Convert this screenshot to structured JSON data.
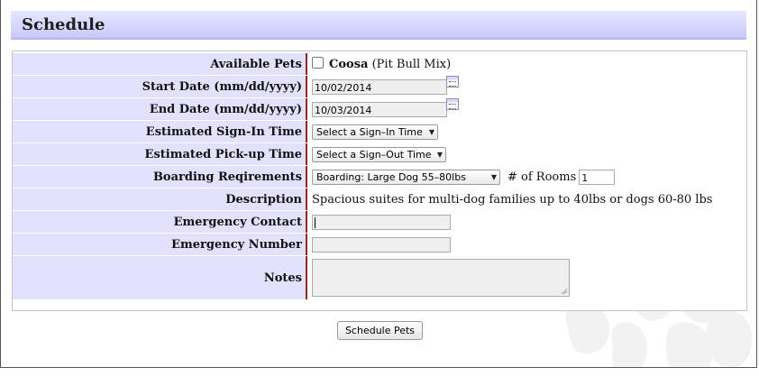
{
  "header": {
    "title": "Schedule"
  },
  "form": {
    "available_pets": {
      "label": "Available Pets",
      "pet_name": "Coosa",
      "pet_breed": "(Pit Bull Mix)",
      "checked": false
    },
    "start_date": {
      "label": "Start Date (mm/dd/yyyy)",
      "value": "10/02/2014"
    },
    "end_date": {
      "label": "End Date (mm/dd/yyyy)",
      "value": "10/03/2014"
    },
    "sign_in": {
      "label": "Estimated Sign-In Time",
      "selected": "Select a Sign–In Time"
    },
    "pick_up": {
      "label": "Estimated Pick-up Time",
      "selected": "Select a Sign–Out Time"
    },
    "boarding": {
      "label": "Boarding Reqirements",
      "selected": "Boarding: Large Dog 55–80lbs",
      "rooms_label": "# of Rooms",
      "rooms_value": "1"
    },
    "description": {
      "label": "Description",
      "text": "Spacious suites for multi-dog families up to 40lbs or dogs 60-80 lbs"
    },
    "emergency_contact": {
      "label": "Emergency Contact",
      "value": ""
    },
    "emergency_number": {
      "label": "Emergency Number",
      "value": ""
    },
    "notes": {
      "label": "Notes",
      "value": ""
    }
  },
  "actions": {
    "submit_label": "Schedule Pets"
  },
  "icons": {
    "calendar": "calendar-icon",
    "dropdown": "chevron-down-icon",
    "resize": "resize-grip-icon",
    "watermark": "paw-watermark"
  },
  "colors": {
    "label_bg": "#e2e2ff",
    "header_bg": "#d7d7ff",
    "label_border": "#8a2a2a"
  }
}
